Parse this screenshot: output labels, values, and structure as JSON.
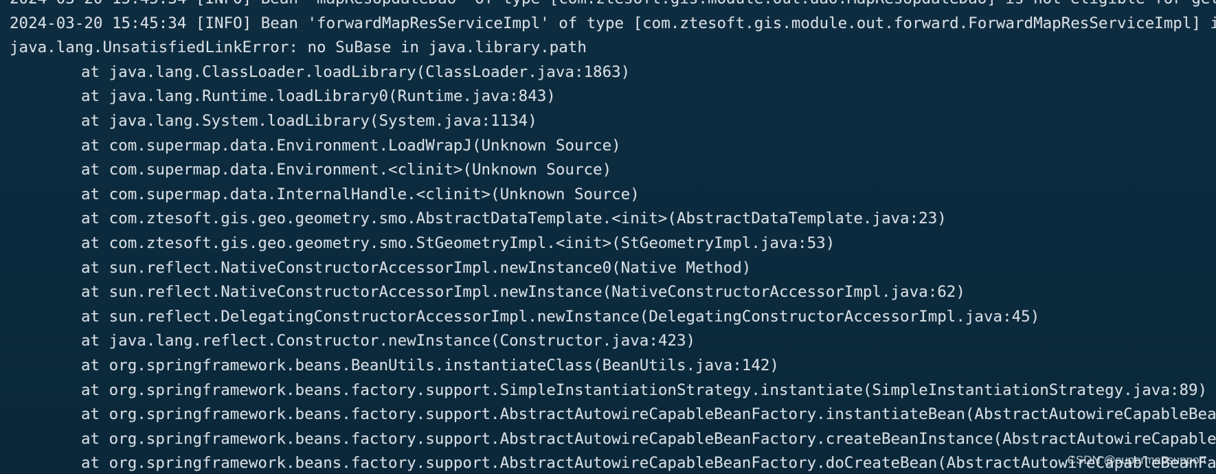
{
  "log": {
    "header_lines": [
      "2024-03-20 15:45:34 [INFO] Bean 'mapResUpdateDao' of type [com.ztesoft.gis.module.out.dao.MapResUpdateDao] is not eligible for getting",
      "2024-03-20 15:45:34 [INFO] Bean 'forwardMapResServiceImpl' of type [com.ztesoft.gis.module.out.forward.ForwardMapResServiceImpl] is not"
    ],
    "error_line": "java.lang.UnsatisfiedLinkError: no SuBase in java.library.path",
    "stack_frames": [
      "at java.lang.ClassLoader.loadLibrary(ClassLoader.java:1863)",
      "at java.lang.Runtime.loadLibrary0(Runtime.java:843)",
      "at java.lang.System.loadLibrary(System.java:1134)",
      "at com.supermap.data.Environment.LoadWrapJ(Unknown Source)",
      "at com.supermap.data.Environment.<clinit>(Unknown Source)",
      "at com.supermap.data.InternalHandle.<clinit>(Unknown Source)",
      "at com.ztesoft.gis.geo.geometry.smo.AbstractDataTemplate.<init>(AbstractDataTemplate.java:23)",
      "at com.ztesoft.gis.geo.geometry.smo.StGeometryImpl.<init>(StGeometryImpl.java:53)",
      "at sun.reflect.NativeConstructorAccessorImpl.newInstance0(Native Method)",
      "at sun.reflect.NativeConstructorAccessorImpl.newInstance(NativeConstructorAccessorImpl.java:62)",
      "at sun.reflect.DelegatingConstructorAccessorImpl.newInstance(DelegatingConstructorAccessorImpl.java:45)",
      "at java.lang.reflect.Constructor.newInstance(Constructor.java:423)",
      "at org.springframework.beans.BeanUtils.instantiateClass(BeanUtils.java:142)",
      "at org.springframework.beans.factory.support.SimpleInstantiationStrategy.instantiate(SimpleInstantiationStrategy.java:89)",
      "at org.springframework.beans.factory.support.AbstractAutowireCapableBeanFactory.instantiateBean(AbstractAutowireCapableBeanFac",
      "at org.springframework.beans.factory.support.AbstractAutowireCapableBeanFactory.createBeanInstance(AbstractAutowireCapableBean",
      "at org.springframework.beans.factory.support.AbstractAutowireCapableBeanFactory.doCreateBean(AbstractAutowireCapableBeanFacto"
    ]
  },
  "watermark": "CSDN @supermapsupport",
  "colors": {
    "background": "#0c2a3e",
    "text": "#d8dee4"
  }
}
